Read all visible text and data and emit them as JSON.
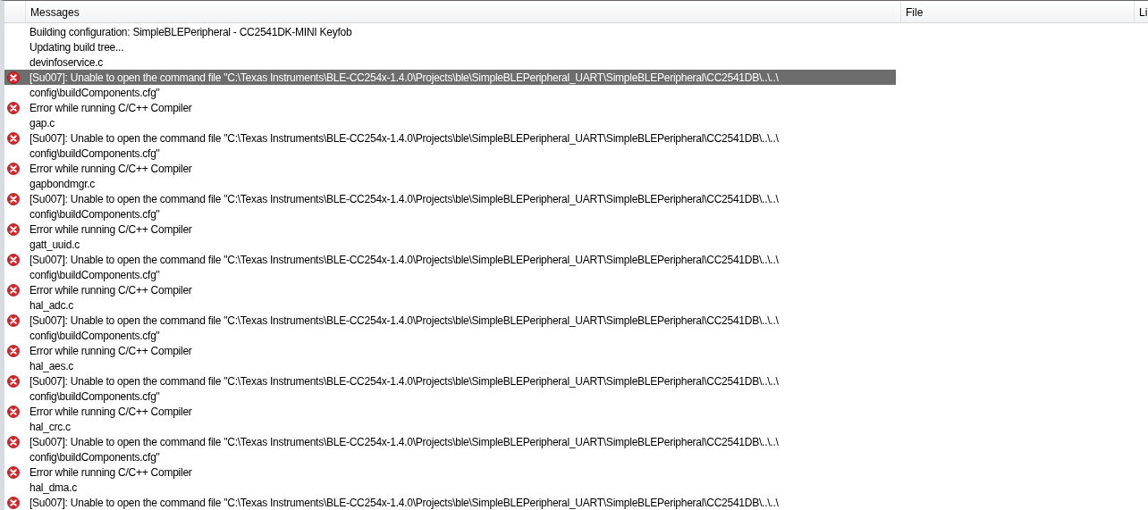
{
  "table": {
    "columns": [
      "Messages",
      "File",
      "Li"
    ],
    "rows": [
      {
        "kind": "info",
        "selected": false,
        "lines": [
          "Building configuration: SimpleBLEPeripheral - CC2541DK-MINI Keyfob"
        ]
      },
      {
        "kind": "info",
        "selected": false,
        "lines": [
          "Updating build tree..."
        ]
      },
      {
        "kind": "info",
        "selected": false,
        "lines": [
          "devinfoservice.c"
        ]
      },
      {
        "kind": "error",
        "selected": true,
        "lines": [
          "[Su007]: Unable to open the command file \"C:\\Texas Instruments\\BLE-CC254x-1.4.0\\Projects\\ble\\SimpleBLEPeripheral_UART\\SimpleBLEPeripheral\\CC2541DB\\..\\..\\",
          "config\\buildComponents.cfg\""
        ]
      },
      {
        "kind": "error",
        "selected": false,
        "lines": [
          "Error while running C/C++ Compiler"
        ]
      },
      {
        "kind": "info",
        "selected": false,
        "lines": [
          "gap.c"
        ]
      },
      {
        "kind": "error",
        "selected": false,
        "lines": [
          "[Su007]: Unable to open the command file \"C:\\Texas Instruments\\BLE-CC254x-1.4.0\\Projects\\ble\\SimpleBLEPeripheral_UART\\SimpleBLEPeripheral\\CC2541DB\\..\\..\\",
          "config\\buildComponents.cfg\""
        ]
      },
      {
        "kind": "error",
        "selected": false,
        "lines": [
          "Error while running C/C++ Compiler"
        ]
      },
      {
        "kind": "info",
        "selected": false,
        "lines": [
          "gapbondmgr.c"
        ]
      },
      {
        "kind": "error",
        "selected": false,
        "lines": [
          "[Su007]: Unable to open the command file \"C:\\Texas Instruments\\BLE-CC254x-1.4.0\\Projects\\ble\\SimpleBLEPeripheral_UART\\SimpleBLEPeripheral\\CC2541DB\\..\\..\\",
          "config\\buildComponents.cfg\""
        ]
      },
      {
        "kind": "error",
        "selected": false,
        "lines": [
          "Error while running C/C++ Compiler"
        ]
      },
      {
        "kind": "info",
        "selected": false,
        "lines": [
          "gatt_uuid.c"
        ]
      },
      {
        "kind": "error",
        "selected": false,
        "lines": [
          "[Su007]: Unable to open the command file \"C:\\Texas Instruments\\BLE-CC254x-1.4.0\\Projects\\ble\\SimpleBLEPeripheral_UART\\SimpleBLEPeripheral\\CC2541DB\\..\\..\\",
          "config\\buildComponents.cfg\""
        ]
      },
      {
        "kind": "error",
        "selected": false,
        "lines": [
          "Error while running C/C++ Compiler"
        ]
      },
      {
        "kind": "info",
        "selected": false,
        "lines": [
          "hal_adc.c"
        ]
      },
      {
        "kind": "error",
        "selected": false,
        "lines": [
          "[Su007]: Unable to open the command file \"C:\\Texas Instruments\\BLE-CC254x-1.4.0\\Projects\\ble\\SimpleBLEPeripheral_UART\\SimpleBLEPeripheral\\CC2541DB\\..\\..\\",
          "config\\buildComponents.cfg\""
        ]
      },
      {
        "kind": "error",
        "selected": false,
        "lines": [
          "Error while running C/C++ Compiler"
        ]
      },
      {
        "kind": "info",
        "selected": false,
        "lines": [
          "hal_aes.c"
        ]
      },
      {
        "kind": "error",
        "selected": false,
        "lines": [
          "[Su007]: Unable to open the command file \"C:\\Texas Instruments\\BLE-CC254x-1.4.0\\Projects\\ble\\SimpleBLEPeripheral_UART\\SimpleBLEPeripheral\\CC2541DB\\..\\..\\",
          "config\\buildComponents.cfg\""
        ]
      },
      {
        "kind": "error",
        "selected": false,
        "lines": [
          "Error while running C/C++ Compiler"
        ]
      },
      {
        "kind": "info",
        "selected": false,
        "lines": [
          "hal_crc.c"
        ]
      },
      {
        "kind": "error",
        "selected": false,
        "lines": [
          "[Su007]: Unable to open the command file \"C:\\Texas Instruments\\BLE-CC254x-1.4.0\\Projects\\ble\\SimpleBLEPeripheral_UART\\SimpleBLEPeripheral\\CC2541DB\\..\\..\\",
          "config\\buildComponents.cfg\""
        ]
      },
      {
        "kind": "error",
        "selected": false,
        "lines": [
          "Error while running C/C++ Compiler"
        ]
      },
      {
        "kind": "info",
        "selected": false,
        "lines": [
          "hal_dma.c"
        ]
      },
      {
        "kind": "error",
        "selected": false,
        "lines": [
          "[Su007]: Unable to open the command file \"C:\\Texas Instruments\\BLE-CC254x-1.4.0\\Projects\\ble\\SimpleBLEPeripheral_UART\\SimpleBLEPeripheral\\CC2541DB\\..\\..\\"
        ]
      }
    ]
  }
}
